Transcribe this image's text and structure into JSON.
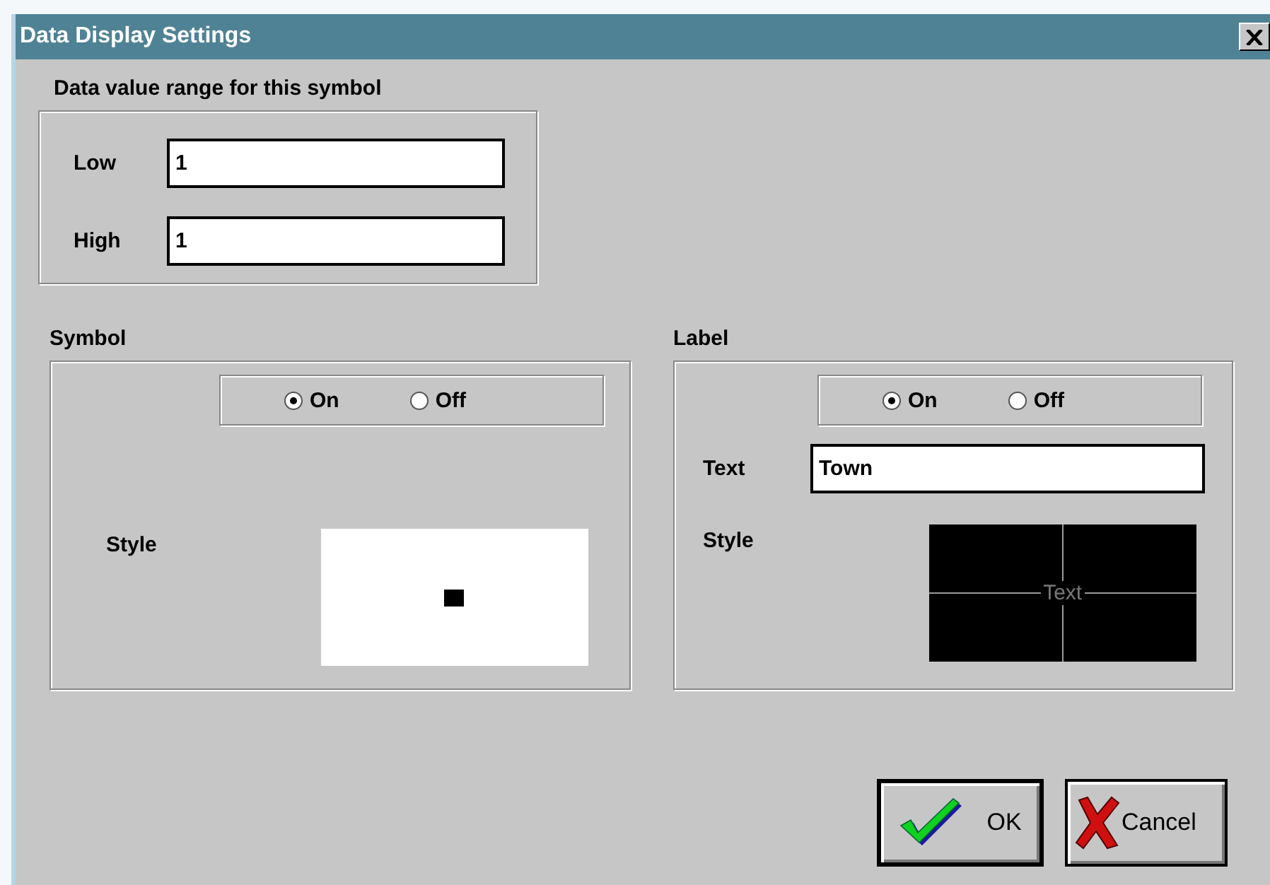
{
  "window": {
    "title": "Data Display Settings"
  },
  "range": {
    "title": "Data value range for this symbol",
    "fields": [
      {
        "label": "Low",
        "value": "1"
      },
      {
        "label": "High",
        "value": "1"
      }
    ]
  },
  "symbol": {
    "title": "Symbol",
    "radios": [
      {
        "label": "On",
        "selected": true
      },
      {
        "label": "Off",
        "selected": false
      }
    ],
    "style_label": "Style"
  },
  "label": {
    "title": "Label",
    "radios": [
      {
        "label": "On",
        "selected": true
      },
      {
        "label": "Off",
        "selected": false
      }
    ],
    "text_label": "Text",
    "text_value": "Town",
    "style_label": "Style",
    "preview_text": "Text"
  },
  "buttons": [
    {
      "kind": "ok",
      "label": "OK"
    },
    {
      "kind": "cancel",
      "label": "Cancel"
    }
  ]
}
